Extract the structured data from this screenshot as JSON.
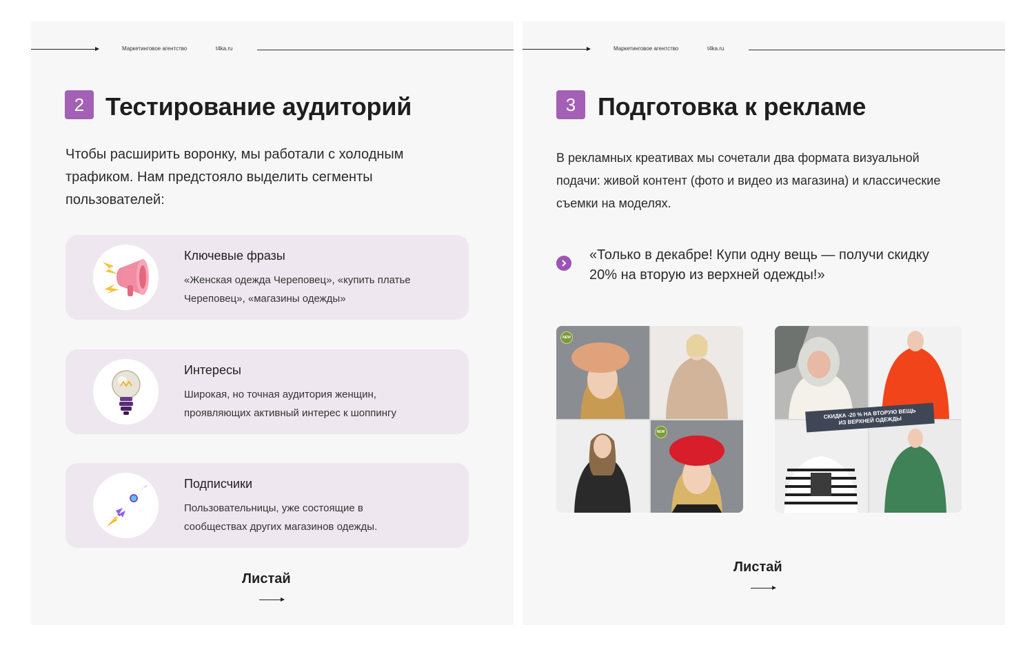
{
  "header": {
    "agency": "Маркетинговое агентство",
    "site": "t4ka.ru"
  },
  "slide_left": {
    "number": "2",
    "title": "Тестирование аудиторий",
    "intro_lines": [
      "Чтобы расширить воронку, мы работали с холодным",
      "трафиком. Нам предстояло выделить сегменты",
      "пользователей:"
    ],
    "cards": [
      {
        "title": "Ключевые фразы",
        "lines": [
          "«Женская одежда Череповец», «купить платье",
          "Череповец», «магазины одежды»"
        ],
        "icon": "megaphone-icon"
      },
      {
        "title": "Интересы",
        "lines": [
          "Широкая, но точная аудитория женщин,",
          "проявляющих активный интерес к шоппингу"
        ],
        "icon": "lightbulb-icon"
      },
      {
        "title": "Подписчики",
        "lines": [
          "Пользовательницы, уже состоящие в",
          "сообществах других магазинов одежды."
        ],
        "icon": "rocket-icon"
      }
    ],
    "swipe": "Листай"
  },
  "slide_right": {
    "number": "3",
    "title": "Подготовка к рекламе",
    "intro_lines": [
      "В рекламных креативах мы сочетали два формата визуальной",
      "подачи: живой контент (фото и видео из магазина) и классические",
      "съемки на моделях."
    ],
    "quote_lines": [
      "«Только в декабре! Купи одну вещь — получи скидку",
      "20% на вторую из верхней одежды!»"
    ],
    "new_badge": "NEW",
    "promo_lines": [
      "СКИДКА -20 % НА ВТОРУЮ ВЕЩЬ",
      "ИЗ ВЕРХНЕЙ ОДЕЖДЫ"
    ],
    "swipe": "Листай"
  },
  "colors": {
    "accent": "#a45fb6",
    "card_bg": "#efe7ef",
    "slide_bg": "#f7f7f7"
  }
}
